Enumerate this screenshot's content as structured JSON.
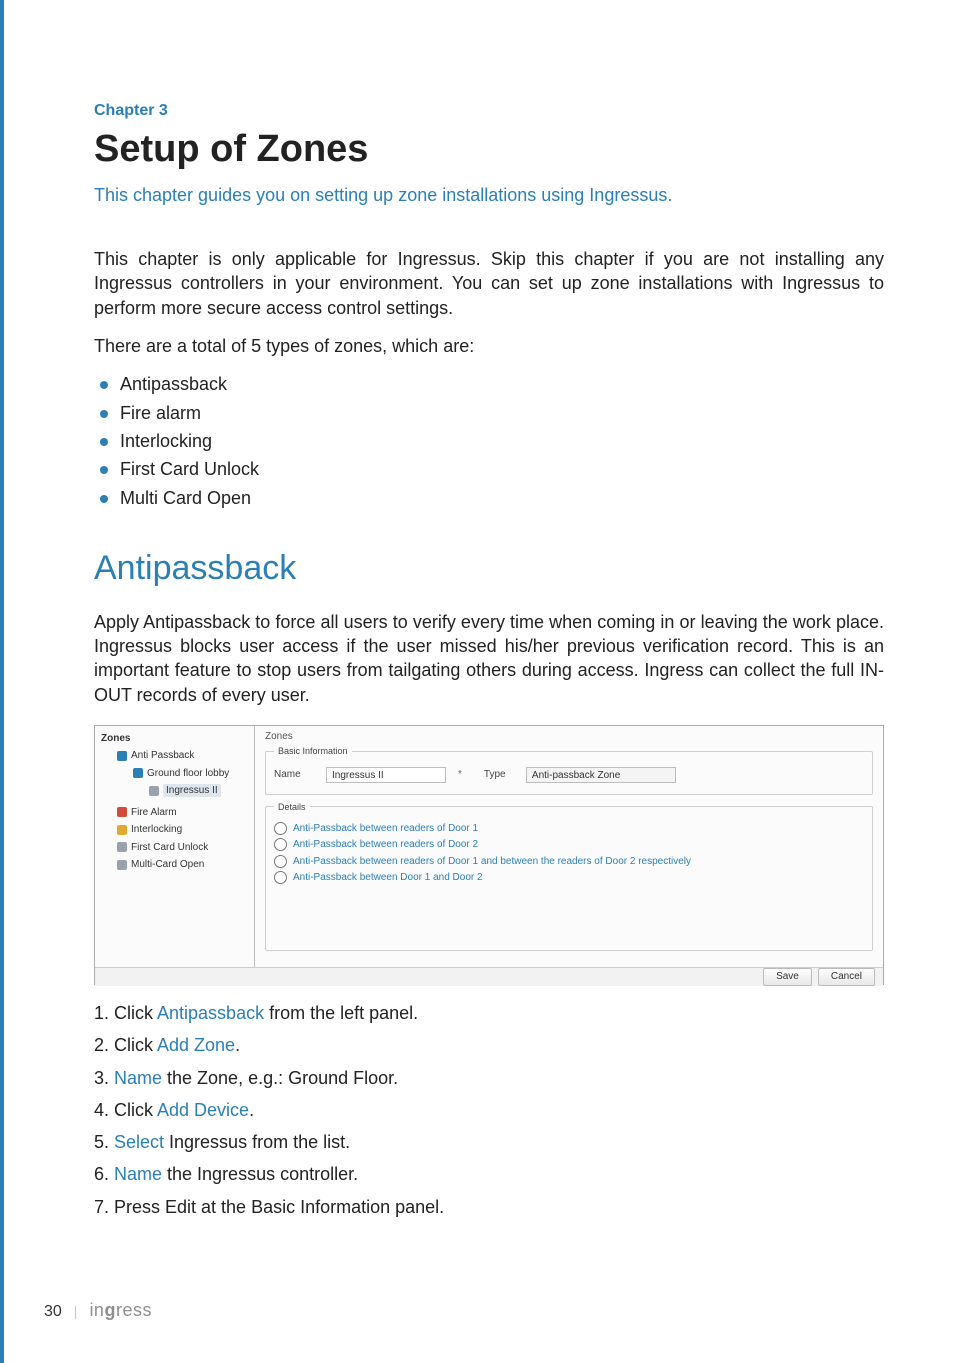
{
  "chapter": {
    "label": "Chapter 3",
    "title": "Setup of Zones",
    "subtitle": "This chapter guides you on setting up zone installations using Ingressus."
  },
  "intro": {
    "p1": "This chapter is only applicable for Ingressus. Skip this chapter if you are not installing any Ingressus controllers in your environment. You can set up zone installations with Ingressus to perform more secure access control settings.",
    "p2": "There are a total of 5 types of zones, which are:"
  },
  "types": [
    "Antipassback",
    "Fire alarm",
    "Interlocking",
    "First Card Unlock",
    "Multi Card Open"
  ],
  "section": {
    "title": "Antipassback",
    "body": "Apply Antipassback to force all users to verify every time when coming in or leaving the work place. Ingressus blocks user access if the user missed his/her previous verification record. This is an important feature to stop users from tailgating others during access. Ingress can collect the full IN-OUT records of every user."
  },
  "screenshot": {
    "side": {
      "root": "Zones",
      "tree": [
        {
          "label": "Anti Passback",
          "icon": "shield",
          "children": [
            {
              "label": "Ground floor lobby",
              "icon": "shield",
              "children": [
                {
                  "label": "Ingressus II",
                  "icon": "tag",
                  "selected": true
                }
              ]
            }
          ]
        },
        {
          "label": "Fire Alarm",
          "icon": "fire"
        },
        {
          "label": "Interlocking",
          "icon": "lock"
        },
        {
          "label": "First Card Unlock",
          "icon": "card"
        },
        {
          "label": "Multi-Card Open",
          "icon": "cards"
        }
      ]
    },
    "main": {
      "title": "Zones",
      "basic": {
        "legend": "Basic Information",
        "name_label": "Name",
        "name_value": "Ingressus II",
        "type_label": "Type",
        "type_value": "Anti-passback Zone"
      },
      "details": {
        "legend": "Details",
        "options": [
          "Anti-Passback between readers of Door 1",
          "Anti-Passback between readers of Door 2",
          "Anti-Passback between readers of Door 1 and between the readers of Door 2 respectively",
          "Anti-Passback between Door 1 and Door 2"
        ]
      }
    },
    "buttons": {
      "save": "Save",
      "cancel": "Cancel"
    }
  },
  "steps": [
    {
      "pre": "Click ",
      "link": "Antipassback",
      "post": " from the left panel."
    },
    {
      "pre": "Click ",
      "link": "Add Zone",
      "post": "."
    },
    {
      "pre": "",
      "link": "Name",
      "post": " the Zone, e.g.: Ground Floor."
    },
    {
      "pre": "Click ",
      "link": "Add Device",
      "post": "."
    },
    {
      "pre": "",
      "link": "Select",
      "post": " Ingressus from the list."
    },
    {
      "pre": "",
      "link": "Name",
      "post": " the Ingressus controller."
    },
    {
      "pre": "Press Edit at the Basic Information panel.",
      "link": "",
      "post": ""
    }
  ],
  "footer": {
    "page": "30",
    "brand_pre": "in",
    "brand_bold": "g",
    "brand_post": "ress"
  }
}
